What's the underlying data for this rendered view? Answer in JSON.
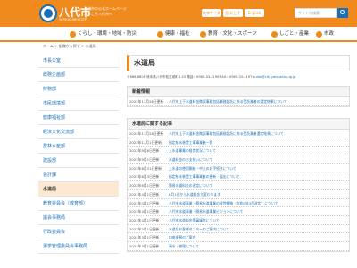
{
  "header": {
    "site_name": "八代市",
    "site_sub": "YATSUSHIRO CITY",
    "tagline_1": "八代市の公式ホームページ",
    "tagline_2": "ようこそ八代市へ",
    "buttons": [
      "文字サイズ",
      "読み上げ",
      "English"
    ],
    "search_placeholder": "サイト内検索"
  },
  "gnav": [
    "くらし・環境・地域・防災",
    "健康・福祉",
    "教育・文化・スポーツ",
    "しごと・産業",
    "市政"
  ],
  "breadcrumb": "ホーム > 組織から探す > 水道局",
  "sidebar": [
    "市長公室",
    "総務企画部",
    "財務部",
    "市民環境部",
    "健康福祉部",
    "経済文化交流部",
    "農林水産部",
    "建設部",
    "会計課",
    "水道局",
    "教育委員会（教育部）",
    "議会事務局",
    "行政委員会",
    "選挙管理委員会事務局"
  ],
  "sidebar_active_index": 9,
  "main": {
    "title": "水道局",
    "contact_prefix": "〒866-8601 熊本県八代市松江城町1-25 電話：0965-33-4196 FAX：0965-33-4197 ",
    "contact_email": "suido@city.yatsushiro.lg.jp",
    "news": {
      "heading": "新着情報",
      "items": [
        {
          "date": "2022年11月28日更新",
          "title": "八代市上下水道料金徴収事務包括業務委託に係る受託業者の選定結果について"
        }
      ]
    },
    "related": {
      "heading": "水道局に関する記事",
      "items": [
        {
          "date": "2022年11月28日更新",
          "title": "八代市上下水道料金徴収事務包括業務委託に係る受託業者選定結果について"
        },
        {
          "date": "2022年11月1日更新",
          "title": "指定給水装置工事事業者一覧"
        },
        {
          "date": "2022年9月6日更新",
          "title": "上水道事業の経営状況について"
        },
        {
          "date": "2022年9月1日更新",
          "title": "水道料金のお支払いについて"
        },
        {
          "date": "2022年8月31日更新",
          "title": "上水道の使用開始・中止のお手続きについて"
        },
        {
          "date": "2022年6月3日更新",
          "title": "指定給水装置工事事業者の更新・届出について"
        },
        {
          "date": "2022年6月1日更新",
          "title": "簡易水道料金の改定について"
        },
        {
          "date": "2022年4月1日更新",
          "title": "6月1日から水道料金が変わります"
        },
        {
          "date": "2022年4月1日更新",
          "title": "八代市水道事業・簡易水道事業の経営戦略（令和4年3月改定）について"
        },
        {
          "date": "2022年4月1日更新",
          "title": "八代市水道事業・簡易水道事業ビジョンについて"
        },
        {
          "date": "2022年4月1日更新",
          "title": "八代市水道料金等審議会について"
        },
        {
          "date": "2022年3月1日更新",
          "title": "水道局お客様センターのご案内について"
        },
        {
          "date": "2022年3月1日更新",
          "title": "口座振替のご案内"
        },
        {
          "date": "2022年3月1日更新",
          "title": "漏水・修理について"
        }
      ]
    }
  },
  "colors": {
    "brand_orange": "#f08a1c",
    "link_blue": "#1c6fb5",
    "active_bg": "#fde9d1"
  }
}
